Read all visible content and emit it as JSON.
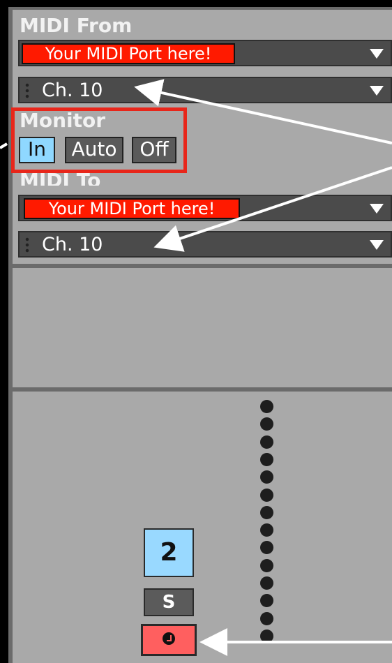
{
  "midi_from": {
    "label": "MIDI From",
    "port": "Your MIDI Port here!",
    "channel": "Ch. 10"
  },
  "monitor": {
    "label": "Monitor",
    "options": [
      "In",
      "Auto",
      "Off"
    ],
    "selected": "In"
  },
  "midi_to": {
    "label": "MIDI To",
    "port": "Your MIDI Port here!",
    "channel": "Ch. 10"
  },
  "track": {
    "number": "2",
    "solo_label": "S"
  },
  "colors": {
    "port_highlight": "#ff1a00",
    "monitor_active": "#8fd8ff",
    "callout_box": "#e8261a",
    "arm_button": "#ff5f5f",
    "panel_bg": "#a9a9a9"
  },
  "icons": {
    "dropdown": "triangle-down-icon",
    "arm": "record-arm-icon",
    "grip": "drag-handle-icon"
  }
}
